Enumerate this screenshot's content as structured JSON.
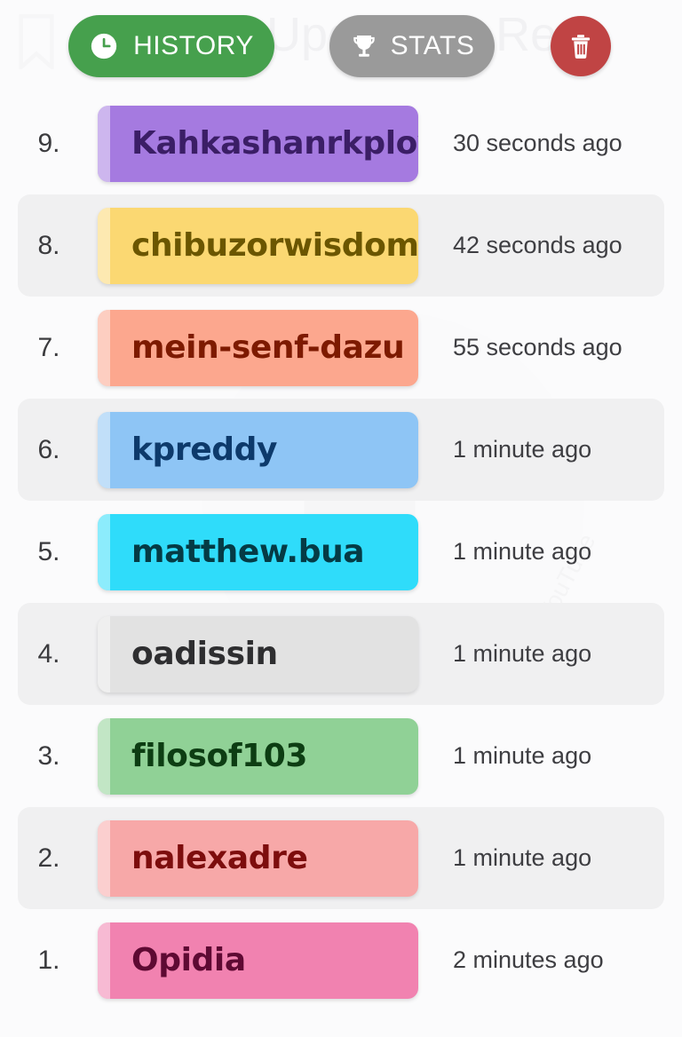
{
  "background": {
    "page_color": "#fbfbfc",
    "watermark_title": "Upcoming Re",
    "watermark_diagonal": "YouTube",
    "bookmark_icon": "bookmark-icon",
    "ghost_icon": "ghost-icon"
  },
  "header": {
    "history_button": {
      "label": "HISTORY",
      "icon": "clock-icon",
      "color": "#46a04d",
      "text_color": "#ffffff"
    },
    "stats_button": {
      "label": "STATS",
      "icon": "trophy-icon",
      "color": "#9a9a9a",
      "text_color": "#ffffff"
    },
    "delete_button": {
      "label": "",
      "icon": "trash-icon",
      "color": "#c04444",
      "text_color": "#ffffff"
    }
  },
  "list": {
    "rows": [
      {
        "rank": "9.",
        "name": "Kahkashanrkploy",
        "time": "30 seconds ago",
        "pill_color": "#a униз"
      }
    ]
  },
  "history": {
    "entries": [
      {
        "rank": "9.",
        "name": "Kahkashanrkploy",
        "time": "30 seconds ago",
        "pill_color": "#a57ae0",
        "text_color": "#3b1e66",
        "striped": false
      },
      {
        "rank": "8.",
        "name": "chibuzorwisdom",
        "time": "42 seconds ago",
        "pill_color": "#fbd872",
        "text_color": "#6b5600",
        "striped": true
      },
      {
        "rank": "7.",
        "name": "mein-senf-dazu",
        "time": "55 seconds ago",
        "pill_color": "#fca78e",
        "text_color": "#7d1a00",
        "striped": false
      },
      {
        "rank": "6.",
        "name": "kpreddy",
        "time": "1 minute ago",
        "pill_color": "#8ec5f5",
        "text_color": "#0d3a6b",
        "striped": true
      },
      {
        "rank": "5.",
        "name": "matthew.bua",
        "time": "1 minute ago",
        "pill_color": "#2fdcfa",
        "text_color": "#053b45",
        "striped": false
      },
      {
        "rank": "4.",
        "name": "oadissin",
        "time": "1 minute ago",
        "pill_color": "#e2e2e2",
        "text_color": "#2e2e30",
        "striped": true
      },
      {
        "rank": "3.",
        "name": "filosof103",
        "time": "1 minute ago",
        "pill_color": "#90d196",
        "text_color": "#0d3d13",
        "striped": false
      },
      {
        "rank": "2.",
        "name": "nalexadre",
        "time": "1 minute ago",
        "pill_color": "#f7a8a8",
        "text_color": "#7d0d0d",
        "striped": true
      },
      {
        "rank": "1.",
        "name": "Opidia",
        "time": "2 minutes ago",
        "pill_color": "#f182b0",
        "text_color": "#5e0a33",
        "striped": false
      }
    ]
  }
}
